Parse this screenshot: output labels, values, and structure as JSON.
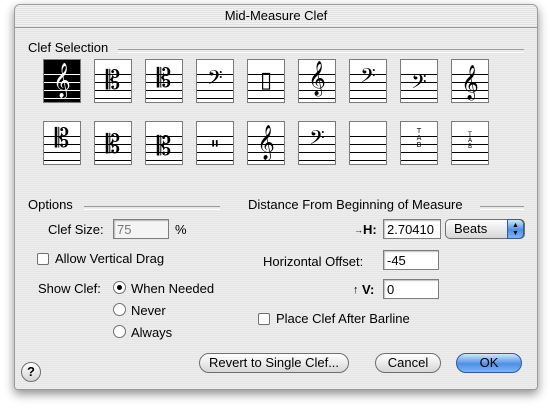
{
  "window": {
    "title": "Mid-Measure Clef"
  },
  "clef_selection": {
    "title": "Clef Selection",
    "clefs": [
      {
        "icon": "treble-clef-icon",
        "selected": true
      },
      {
        "icon": "alto-clef-icon",
        "selected": false
      },
      {
        "icon": "tenor-clef-icon",
        "selected": false
      },
      {
        "icon": "bass-clef-icon",
        "selected": false
      },
      {
        "icon": "percussion-clef-icon",
        "selected": false
      },
      {
        "icon": "treble-8vb-clef-icon",
        "selected": false
      },
      {
        "icon": "bass-8vb-clef-icon",
        "selected": false
      },
      {
        "icon": "baritone-clef-icon",
        "selected": false
      },
      {
        "icon": "french-violin-clef-icon",
        "selected": false
      },
      {
        "icon": "soprano-clef-icon",
        "selected": false
      },
      {
        "icon": "mezzo-soprano-clef-icon",
        "selected": false
      },
      {
        "icon": "baritone-c-clef-icon",
        "selected": false
      },
      {
        "icon": "percussion-clef-2-icon",
        "selected": false
      },
      {
        "icon": "treble-8va-clef-icon",
        "selected": false
      },
      {
        "icon": "bass-8va-clef-icon",
        "selected": false
      },
      {
        "icon": "blank-clef-icon",
        "selected": false
      },
      {
        "icon": "tab-clef-icon",
        "selected": false
      },
      {
        "icon": "tab-clef-small-icon",
        "selected": false
      }
    ]
  },
  "options": {
    "title": "Options",
    "clef_size_label": "Clef Size:",
    "clef_size_value": "75",
    "clef_size_unit": "%",
    "allow_vertical_drag_label": "Allow Vertical Drag",
    "allow_vertical_drag": false,
    "show_clef_label": "Show Clef:",
    "show_clef_options": [
      "When Needed",
      "Never",
      "Always"
    ],
    "show_clef_selected": "When Needed"
  },
  "distance": {
    "title": "Distance From Beginning of Measure",
    "h_label": "H:",
    "h_value": "2.70410",
    "units_value": "Beats",
    "horizontal_offset_label": "Horizontal Offset:",
    "horizontal_offset_value": "-45",
    "v_label": "V:",
    "v_value": "0",
    "place_after_barline_label": "Place Clef After Barline",
    "place_after_barline": false
  },
  "buttons": {
    "help": "?",
    "revert": "Revert to Single Clef...",
    "cancel": "Cancel",
    "ok": "OK"
  },
  "colors": {
    "default_button": "#4e90e6",
    "selected_clef_bg": "#000000"
  }
}
